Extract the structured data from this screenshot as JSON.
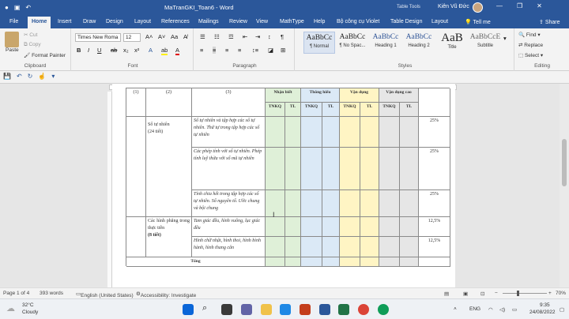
{
  "window": {
    "title": "MaTranGKI_Toan6  -  Word",
    "table_tools": "Table Tools",
    "user": "Kiên Vũ Đức",
    "min": "—",
    "max": "❐",
    "close": "✕"
  },
  "tabs": [
    "File",
    "Home",
    "Insert",
    "Draw",
    "Design",
    "Layout",
    "References",
    "Mailings",
    "Review",
    "View",
    "MathType",
    "Help",
    "Bộ công cụ Violet",
    "Table Design",
    "Layout",
    "Tell me",
    "Share"
  ],
  "clipboard": {
    "paste": "Paste",
    "cut": "Cut",
    "copy": "Copy",
    "format_painter": "Format Painter",
    "label": "Clipboard"
  },
  "font": {
    "name": "Times New Roma",
    "size": "12",
    "label": "Font"
  },
  "paragraph": {
    "label": "Paragraph"
  },
  "styles": {
    "items": [
      {
        "preview": "AaBbCc",
        "name": "¶ Normal"
      },
      {
        "preview": "AaBbCc",
        "name": "¶ No Spac..."
      },
      {
        "preview": "AaBbCc",
        "name": "Heading 1"
      },
      {
        "preview": "AaBbCc",
        "name": "Heading 2"
      },
      {
        "preview": "AaB",
        "name": "Title"
      },
      {
        "preview": "AaBbCcE",
        "name": "Subtitle"
      }
    ],
    "label": "Styles"
  },
  "editing": {
    "find": "Find",
    "replace": "Replace",
    "select": "Select",
    "label": "Editing"
  },
  "ruler": {
    "marks": [
      "1",
      "2",
      "3",
      "4",
      "5",
      "6",
      "7",
      "8",
      "9",
      "10",
      "11",
      "12",
      "13",
      "14",
      "15",
      "16",
      "17",
      "18",
      "19",
      "20",
      "21",
      "22",
      "23",
      "24",
      "25",
      "26"
    ]
  },
  "table": {
    "col_nums": [
      "(1)",
      "(2)",
      "(3)"
    ],
    "groups": [
      "Nhận biết",
      "Thông hiểu",
      "Vận dụng",
      "Vận dụng cao"
    ],
    "sub": [
      "TNKQ",
      "TL",
      "TNKQ",
      "TL",
      "TNKQ",
      "TL",
      "TNKQ",
      "TL"
    ],
    "rows": [
      {
        "topic": "Số tự nhiên",
        "hours": "(24 tiết)",
        "content": "Số tự nhiên và tập hợp các số tự nhiên. Thứ tự trong tập hợp các số tự nhiên",
        "pct": "25%"
      },
      {
        "content": "Các phép tính với số tự nhiên. Phép tính luỹ thừa với số mũ tự nhiên",
        "pct": "25%"
      },
      {
        "content": "Tính chia hết trong tập hợp các số tự nhiên. Số nguyên tố. Ước chung và bội chung",
        "pct": "25%"
      },
      {
        "topic": "Các hình phẳng trong thực tiễn",
        "hours": "(8 tiết)",
        "content": "Tam giác đều, hình vuông, lục giác đều",
        "pct": "12,5%"
      },
      {
        "content": "Hình chữ nhật, hình thoi, hình bình hành, hình thang cân",
        "pct": "12,5%"
      }
    ],
    "total": "Tổng"
  },
  "status": {
    "page": "Page 1 of 4",
    "words": "393 words",
    "lang": "English (United States)",
    "access": "Accessibility: Investigate",
    "zoom": "70%"
  },
  "taskbar": {
    "temp": "32°C",
    "weather": "Cloudy",
    "lang": "ENG",
    "time": "9:35",
    "date": "24/08/2022"
  },
  "colors": {
    "accent": "#2b579a",
    "green": "#dff0d8",
    "blue": "#dbe9f6",
    "yellow": "#fff5c4",
    "gray": "#e6e6e6"
  }
}
